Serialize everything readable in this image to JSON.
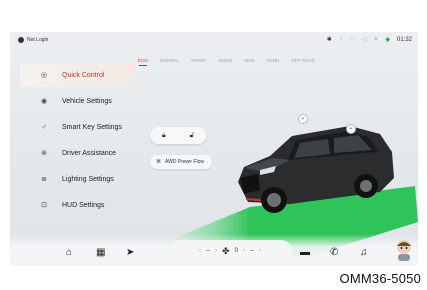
{
  "status_bar": {
    "user_label": "Not Login",
    "time": "01:32"
  },
  "sidebar": {
    "items": [
      {
        "label": "Quick Control",
        "active": true
      },
      {
        "label": "Vehicle Settings",
        "active": false
      },
      {
        "label": "Smart Key Settings",
        "active": false
      },
      {
        "label": "Driver Assistance",
        "active": false
      },
      {
        "label": "Lighting Settings",
        "active": false
      },
      {
        "label": "HUD Settings",
        "active": false
      }
    ]
  },
  "drive_modes": [
    "ECO",
    "NORMAL",
    "SPORT",
    "SNOW",
    "MUD",
    "SAND",
    "OFF-ROAD"
  ],
  "quick_controls": {
    "awd_power_flow_label": "AWD Power Flow"
  },
  "climate": {
    "left_temp": "--",
    "fan_level": "0",
    "right_temp": "--"
  },
  "caption": "OMM36-5050",
  "colors": {
    "accent": "#b43a2c",
    "floor_green": "#2fc45a",
    "background": "#e6eaec"
  }
}
